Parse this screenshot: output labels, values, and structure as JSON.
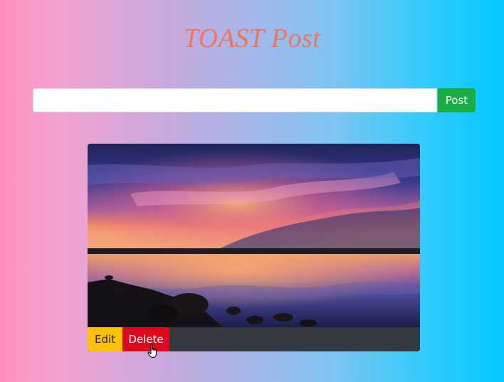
{
  "header": {
    "title": "TOAST Post"
  },
  "composer": {
    "input_value": "",
    "input_placeholder": "",
    "post_label": "Post"
  },
  "post": {
    "image_description": "sunset-over-lake-photo",
    "actions": {
      "edit_label": "Edit",
      "delete_label": "Delete"
    }
  },
  "colors": {
    "title": "#f4735a",
    "post_button": "#1aad45",
    "edit_button": "#ffc107",
    "delete_button": "#dc0a1e",
    "card_footer": "#343a40"
  },
  "icons": {
    "cursor": "hand-pointer-icon"
  }
}
